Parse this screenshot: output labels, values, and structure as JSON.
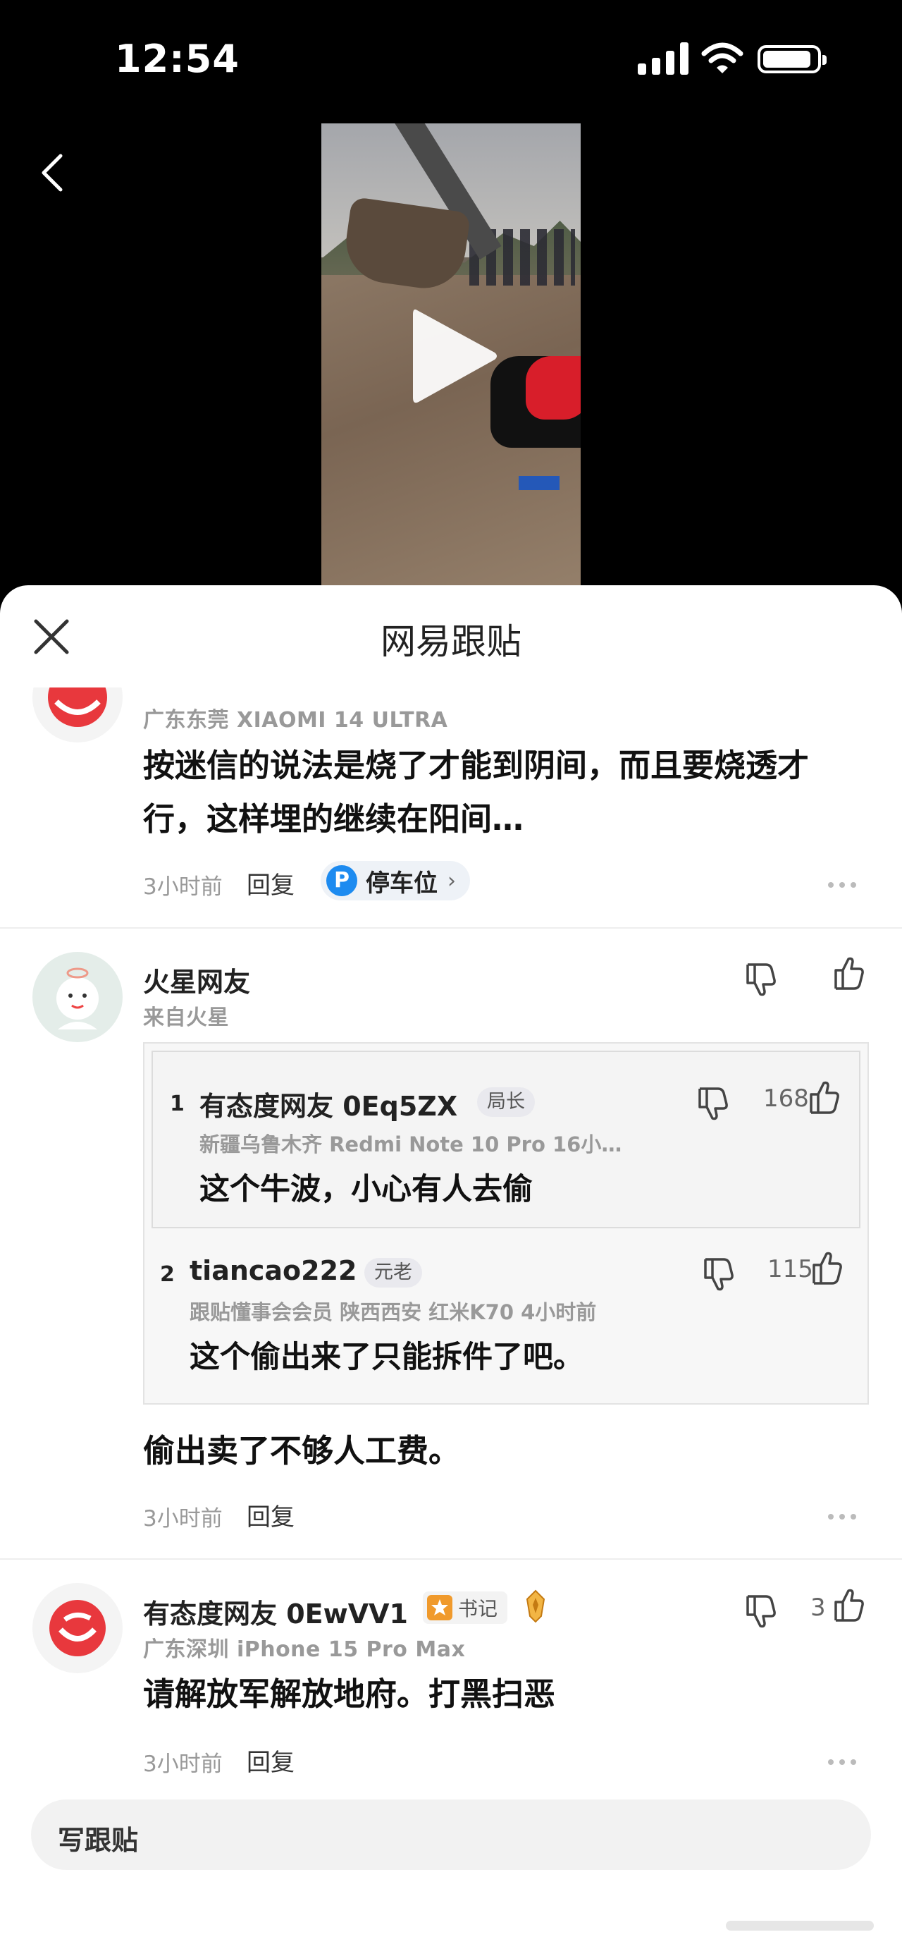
{
  "status_bar": {
    "time": "12:54",
    "battery_level": 0.92
  },
  "sheet": {
    "title": "网易跟贴"
  },
  "comments": [
    {
      "location_device": "广东东莞  XIAOMI 14 ULTRA",
      "text": "按迷信的说法是烧了才能到阴间，而且要烧透才行，这样埋的继续在阳间…",
      "time_ago": "3小时前",
      "reply_label": "回复",
      "tag": {
        "icon_letter": "P",
        "label": "停车位",
        "chevron": "›"
      }
    },
    {
      "username": "火星网友",
      "location": "来自火星",
      "quotes": [
        {
          "index": "1",
          "username": "有态度网友 0Eq5ZX",
          "badge": "局长",
          "meta": "新疆乌鲁木齐  Redmi Note 10 Pro  16小…",
          "text": "这个牛波，小心有人去偷",
          "like_count": "168"
        },
        {
          "index": "2",
          "username": "tiancao222",
          "badge": "元老",
          "meta": "跟贴懂事会会员  陕西西安  红米K70  4小时前",
          "text": "这个偷出来了只能拆件了吧。",
          "like_count": "115"
        }
      ],
      "text": "偷出卖了不够人工费。",
      "time_ago": "3小时前",
      "reply_label": "回复"
    },
    {
      "username": "有态度网友 0EwVV1",
      "badge": "书记",
      "location_device": "广东深圳  iPhone 15 Pro Max",
      "text": "请解放军解放地府。打黑扫恶",
      "time_ago": "3小时前",
      "reply_label": "回复",
      "like_count": "3"
    }
  ],
  "composer": {
    "placeholder": "写跟贴"
  },
  "colors": {
    "accent_blue": "#1d8bf0",
    "brand_red": "#e8383d",
    "badge_orange": "#f09a2c"
  }
}
